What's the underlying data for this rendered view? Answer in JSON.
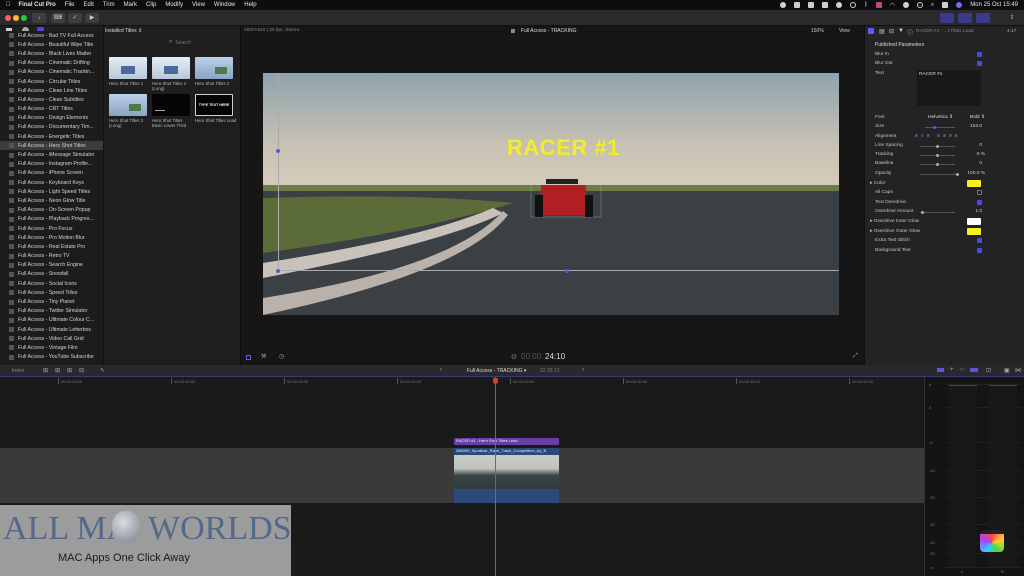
{
  "menubar": {
    "app": "Final Cut Pro",
    "items": [
      "File",
      "Edit",
      "Trim",
      "Mark",
      "Clip",
      "Modify",
      "View",
      "Window",
      "Help"
    ],
    "clock": "Mon 25 Oct  15:49"
  },
  "toolbar": {
    "import_label": "↓",
    "keyword_label": "⌨",
    "check_label": "✓",
    "share_label": "⇧"
  },
  "browser": {
    "source_label": "Installed Titles ⇕",
    "search_placeholder": "Search",
    "thumbnails": [
      {
        "label": "Hero Shot Titles 1"
      },
      {
        "label": "Hero Shot Titles 1 (Long)"
      },
      {
        "label": "Hero Shot Titles 2"
      },
      {
        "label": "Hero Shot Titles 2 (Long)"
      },
      {
        "label": "Hero Shot Titles Basic Lower Third"
      },
      {
        "label": "Hero Shot Titles Lead",
        "preview_text": "TYPE TEXT HERE"
      }
    ]
  },
  "library": {
    "items": [
      "Full Access - Bad TV Full Access",
      "Full Access - Beautiful Wipe Title",
      "Full Access - Black Lives Matter",
      "Full Access - Cinematic Drifting",
      "Full Access - Cinematic Trackin...",
      "Full Access - Circular Titles",
      "Full Access - Clean Line Titles",
      "Full Access - Clean Subtitles",
      "Full Access - CRT Titles",
      "Full Access - Design Elements",
      "Full Access - Documentary Tim...",
      "Full Access - Energetic Titles",
      "Full Access - Hero Shot Titles",
      "Full Access - iMessage Simulator",
      "Full Access - Instagram Profile...",
      "Full Access - iPhone Screen",
      "Full Access - Keyboard Keys",
      "Full Access - Light Speed Titles",
      "Full Access - Neon Glow Title",
      "Full Access - On-Screen Popup",
      "Full Access - Playback Progres...",
      "Full Access - Pro Focus",
      "Full Access - Pro Motion Blur",
      "Full Access - Real Estate Pro",
      "Full Access - Retro TV",
      "Full Access - Search Engine",
      "Full Access - Snowfall",
      "Full Access - Social Icons",
      "Full Access - Speed Titles",
      "Full Access - Tiny Planet",
      "Full Access - Twitter Simulator",
      "Full Access - Ultimate Colour C...",
      "Full Access - Ultimate Letterbox",
      "Full Access - Video Call Grid",
      "Full Access - Vintage Film",
      "Full Access - YouTube Subscribe"
    ],
    "selected_index": 12
  },
  "viewer": {
    "format": "1920×810 | 25 fps, Stereo",
    "project": "Full Access - TRACKING",
    "zoom": "150%",
    "view_label": "View",
    "overlay_text": "RACER #1",
    "timecode_dim": "00:00:",
    "timecode": "24:10"
  },
  "inspector": {
    "title": "RACER #1 - ...t Titles Lead",
    "duration": "4:17",
    "section": "Published Parameters",
    "blur_in_label": "Blur In",
    "blur_out_label": "Blur Out",
    "text_label": "Text",
    "text_value": "RACER #1",
    "font_label": "Font",
    "font_value": "Helvetica ⇕",
    "weight_value": "Bold ⇕",
    "size_label": "Size",
    "size_value": "163.0",
    "alignment_label": "Alignment",
    "line_spacing_label": "Line Spacing",
    "line_spacing_value": "0",
    "tracking_label": "Tracking",
    "tracking_value": "0 %",
    "baseline_label": "Baseline",
    "baseline_value": "0",
    "opacity_label": "Opacity",
    "opacity_value": "100.0 %",
    "color_label": "Color",
    "all_caps_label": "All Caps",
    "text_overdrive_label": "Text Overdrive",
    "overdrive_amount_label": "Overdrive Amount",
    "overdrive_amount_value": "1.0",
    "inner_glow_label": "Overdrive Inner Glow",
    "outer_glow_label": "Overdrive Outer Glow",
    "extra_glitch_label": "Extra Text Glitch",
    "background_text_label": "Background Text",
    "colors": {
      "text": "#f5f01e",
      "inner_glow": "#ffffff",
      "outer_glow": "#f5f01e",
      "check": "#4a4ae0"
    }
  },
  "timeline": {
    "index_label": "Index",
    "project": "Full Access - TRACKING ▾",
    "duration": "02:28:13",
    "ruler": [
      "00:00:05:00",
      "00:00:10:00",
      "00:00:15:00",
      "00:00:20:00",
      "00:00:25:00",
      "00:00:30:00",
      "00:00:35:00",
      "00:00:40:00"
    ],
    "title_clip": "RACER #1 - Hero Shot Titles Lead",
    "video_clip": "386099_Sporticar_Race_Track_Competition_by_B",
    "meter_scale": [
      "6",
      "0",
      "-6",
      "-12",
      "-20",
      "-30",
      "-40",
      "-50",
      "-∞"
    ],
    "meter_channels": [
      "L",
      "R"
    ]
  },
  "watermark": {
    "brand_left": "ALL MA",
    "brand_right": "WORLDS",
    "tagline": "MAC Apps One Click Away"
  }
}
